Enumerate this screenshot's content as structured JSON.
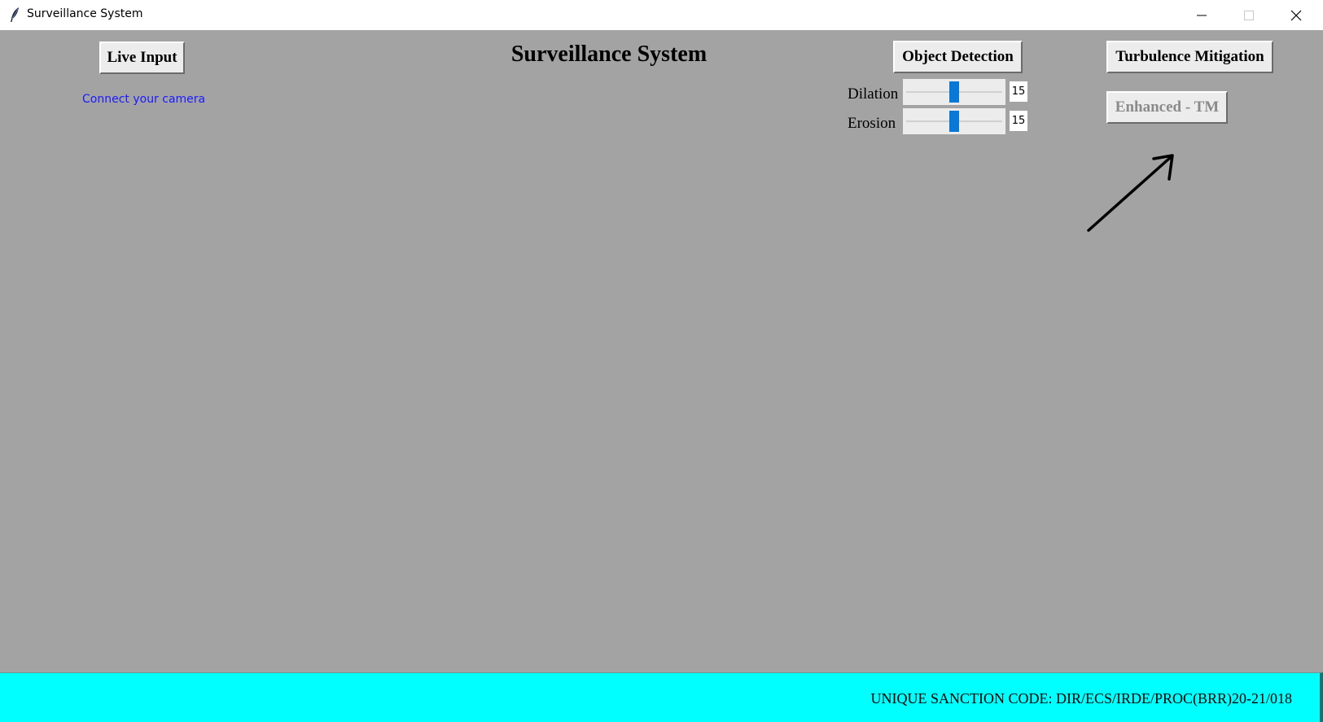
{
  "window": {
    "title": "Surveillance System"
  },
  "header": {
    "title": "Surveillance System"
  },
  "buttons": {
    "live_input": "Live Input",
    "object_detection": "Object Detection",
    "turbulence_mitigation": "Turbulence Mitigation",
    "enhanced_tm": "Enhanced - TM"
  },
  "camera_status": "Connect your camera",
  "sliders": {
    "dilation": {
      "label": "Dilation",
      "value": "15",
      "fraction": 0.5
    },
    "erosion": {
      "label": "Erosion",
      "value": "15",
      "fraction": 0.5
    }
  },
  "footer": {
    "sanction_code": "UNIQUE SANCTION CODE: DIR/ECS/IRDE/PROC(BRR)20-21/018"
  },
  "colors": {
    "background": "#a3a3a3",
    "footer": "#00ffff",
    "slider_thumb": "#0a78d7",
    "status_text": "#1a1aff"
  },
  "icons": [
    "feather-icon",
    "minimize-icon",
    "maximize-icon",
    "close-icon",
    "arrow-icon"
  ]
}
